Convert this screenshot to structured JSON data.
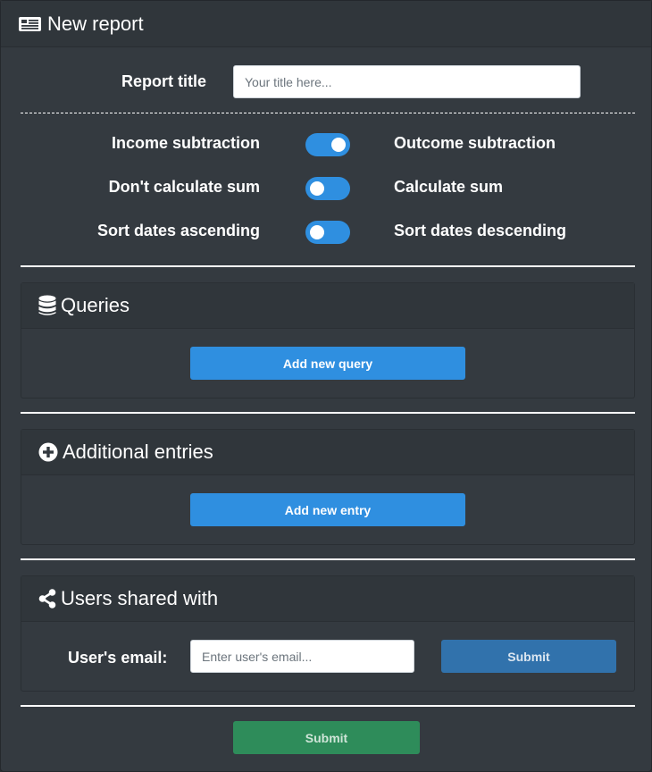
{
  "header": {
    "title": "New report",
    "icon": "newspaper-icon"
  },
  "report_title": {
    "label": "Report title",
    "placeholder": "Your title here..."
  },
  "toggles": [
    {
      "left_label": "Income subtraction",
      "right_label": "Outcome subtraction",
      "state": "right"
    },
    {
      "left_label": "Don't calculate sum",
      "right_label": "Calculate sum",
      "state": "left"
    },
    {
      "left_label": "Sort dates ascending",
      "right_label": "Sort dates descending",
      "state": "left"
    }
  ],
  "queries": {
    "title": "Queries",
    "icon": "database-icon",
    "button_label": "Add new query"
  },
  "entries": {
    "title": "Additional entries",
    "icon": "plus-circle-icon",
    "button_label": "Add new entry"
  },
  "shared": {
    "title": "Users shared with",
    "icon": "share-icon",
    "email_label": "User's email:",
    "email_placeholder": "Enter user's email...",
    "submit_label": "Submit"
  },
  "footer": {
    "submit_label": "Submit"
  },
  "colors": {
    "accent": "#2f8fe0",
    "success": "#2e8c5a",
    "background": "#343a40"
  }
}
